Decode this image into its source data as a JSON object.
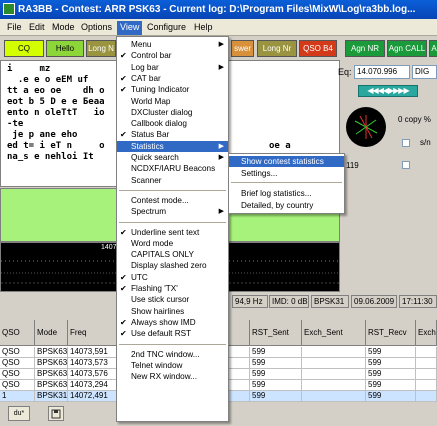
{
  "window": {
    "title": "RA3BB - Contest: ARR PSK63 - Current log: D:\\Program Files\\MixW\\Log\\ra3bb.log..."
  },
  "menubar": {
    "file": "File",
    "edit": "Edit",
    "mode": "Mode",
    "options": "Options",
    "view": "View",
    "configure": "Configure",
    "help": "Help"
  },
  "toolbar": {
    "cq": "CQ",
    "hello": "Hello",
    "long_n": "Long N",
    "answer": "swer",
    "long_nr": "Long Nr",
    "qso_b4": "QSO B4",
    "agn_nr": "Agn NR",
    "agn_call": "Agn CALL",
    "agn_extra": "A",
    "colors": {
      "cq": "#d4ff00",
      "hello": "#8cd63a",
      "olive": "#9a9440",
      "orange": "#d8903a",
      "red": "#d23a1a",
      "green": "#1a9a3a"
    }
  },
  "rx_text": {
    "lines": [
      "i     mz                   t",
      "  .e e o eEM uf       nS   ee n",
      "tt a eo oe    dh o   ds e",
      "eot b 5 D e e Бeaa",
      "ento n oleTtT   io",
      "-te",
      " je p ane eho",
      "ed t= i eT n     o",
      "na_s e nehloi It"
    ],
    "extra_right": [
      "oe a",
      "i",
      ""
    ]
  },
  "right_panel": {
    "eq_label": "Eq:",
    "frequency": "14.070.996",
    "mode": "DIG",
    "arrows": "◀◀◀◀▶▶▶▶",
    "copy": "0   copy %",
    "sn": "s/n",
    "number": "119"
  },
  "spectrum": {
    "label": "1407"
  },
  "statusbar": {
    "freq": "94,9 Hz",
    "imd": "IMD: 0 dB",
    "mode": "BPSK31",
    "date": "09.06.2009",
    "time": "17:11:30"
  },
  "log_table": {
    "columns": [
      "QSO",
      "Mode",
      "Freq",
      "RST_Sent",
      "Exch_Sent",
      "RST_Recv",
      "Exch"
    ],
    "rows": [
      [
        "QSO",
        "BPSK63",
        "14073,591",
        "599",
        "",
        "599",
        ""
      ],
      [
        "QSO",
        "BPSK63",
        "14073,573",
        "599",
        "",
        "599",
        ""
      ],
      [
        "QSO",
        "BPSK63",
        "14073,576",
        "599",
        "",
        "599",
        ""
      ],
      [
        "QSO",
        "BPSK63",
        "14073,294",
        "599",
        "",
        "599",
        ""
      ],
      [
        "1",
        "BPSK31",
        "14072,491",
        "599",
        "",
        "599",
        ""
      ]
    ]
  },
  "view_menu": {
    "items": [
      {
        "label": "Menu",
        "checked": false,
        "submenu": true
      },
      {
        "label": "Control bar",
        "checked": true,
        "submenu": false
      },
      {
        "label": "Log bar",
        "checked": false,
        "submenu": true
      },
      {
        "label": "CAT bar",
        "checked": true,
        "submenu": false
      },
      {
        "label": "Tuning Indicator",
        "checked": true,
        "submenu": false
      },
      {
        "label": "World Map",
        "checked": false,
        "submenu": false
      },
      {
        "label": "DXCluster dialog",
        "checked": false,
        "submenu": false
      },
      {
        "label": "Callbook dialog",
        "checked": false,
        "submenu": false
      },
      {
        "label": "Status Bar",
        "checked": true,
        "submenu": false
      },
      {
        "label": "Statistics",
        "checked": false,
        "submenu": true,
        "highlighted": true
      },
      {
        "label": "Quick search",
        "checked": false,
        "submenu": true
      },
      {
        "label": "NCDXF/IARU Beacons",
        "checked": false,
        "submenu": false
      },
      {
        "label": "Scanner",
        "checked": false,
        "submenu": false
      },
      {
        "label": "Contest mode...",
        "checked": false,
        "submenu": false
      },
      {
        "label": "Spectrum",
        "checked": false,
        "submenu": true
      },
      {
        "label": "Underline sent text",
        "checked": true,
        "submenu": false
      },
      {
        "label": "Word mode",
        "checked": false,
        "submenu": false
      },
      {
        "label": "CAPITALS ONLY",
        "checked": false,
        "submenu": false
      },
      {
        "label": "Display slashed zero",
        "checked": false,
        "submenu": false
      },
      {
        "label": "UTC",
        "checked": true,
        "submenu": false
      },
      {
        "label": "Flashing 'TX'",
        "checked": true,
        "submenu": false
      },
      {
        "label": "Use stick cursor",
        "checked": false,
        "submenu": false
      },
      {
        "label": "Show hairlines",
        "checked": false,
        "submenu": false
      },
      {
        "label": "Always show IMD",
        "checked": true,
        "submenu": false
      },
      {
        "label": "Use default RST",
        "checked": true,
        "submenu": false
      },
      {
        "label": "2nd TNC window...",
        "checked": false,
        "submenu": false
      },
      {
        "label": "Telnet window",
        "checked": false,
        "submenu": false
      },
      {
        "label": "New RX window...",
        "checked": false,
        "submenu": false
      }
    ]
  },
  "statistics_submenu": {
    "items": [
      {
        "label": "Show contest statistics",
        "highlighted": true
      },
      {
        "label": "Settings..."
      },
      {
        "label": "Brief log statistics..."
      },
      {
        "label": "Detailed, by country"
      }
    ]
  },
  "bottom_bar": {
    "btn1": "du*",
    "btn2": ""
  }
}
